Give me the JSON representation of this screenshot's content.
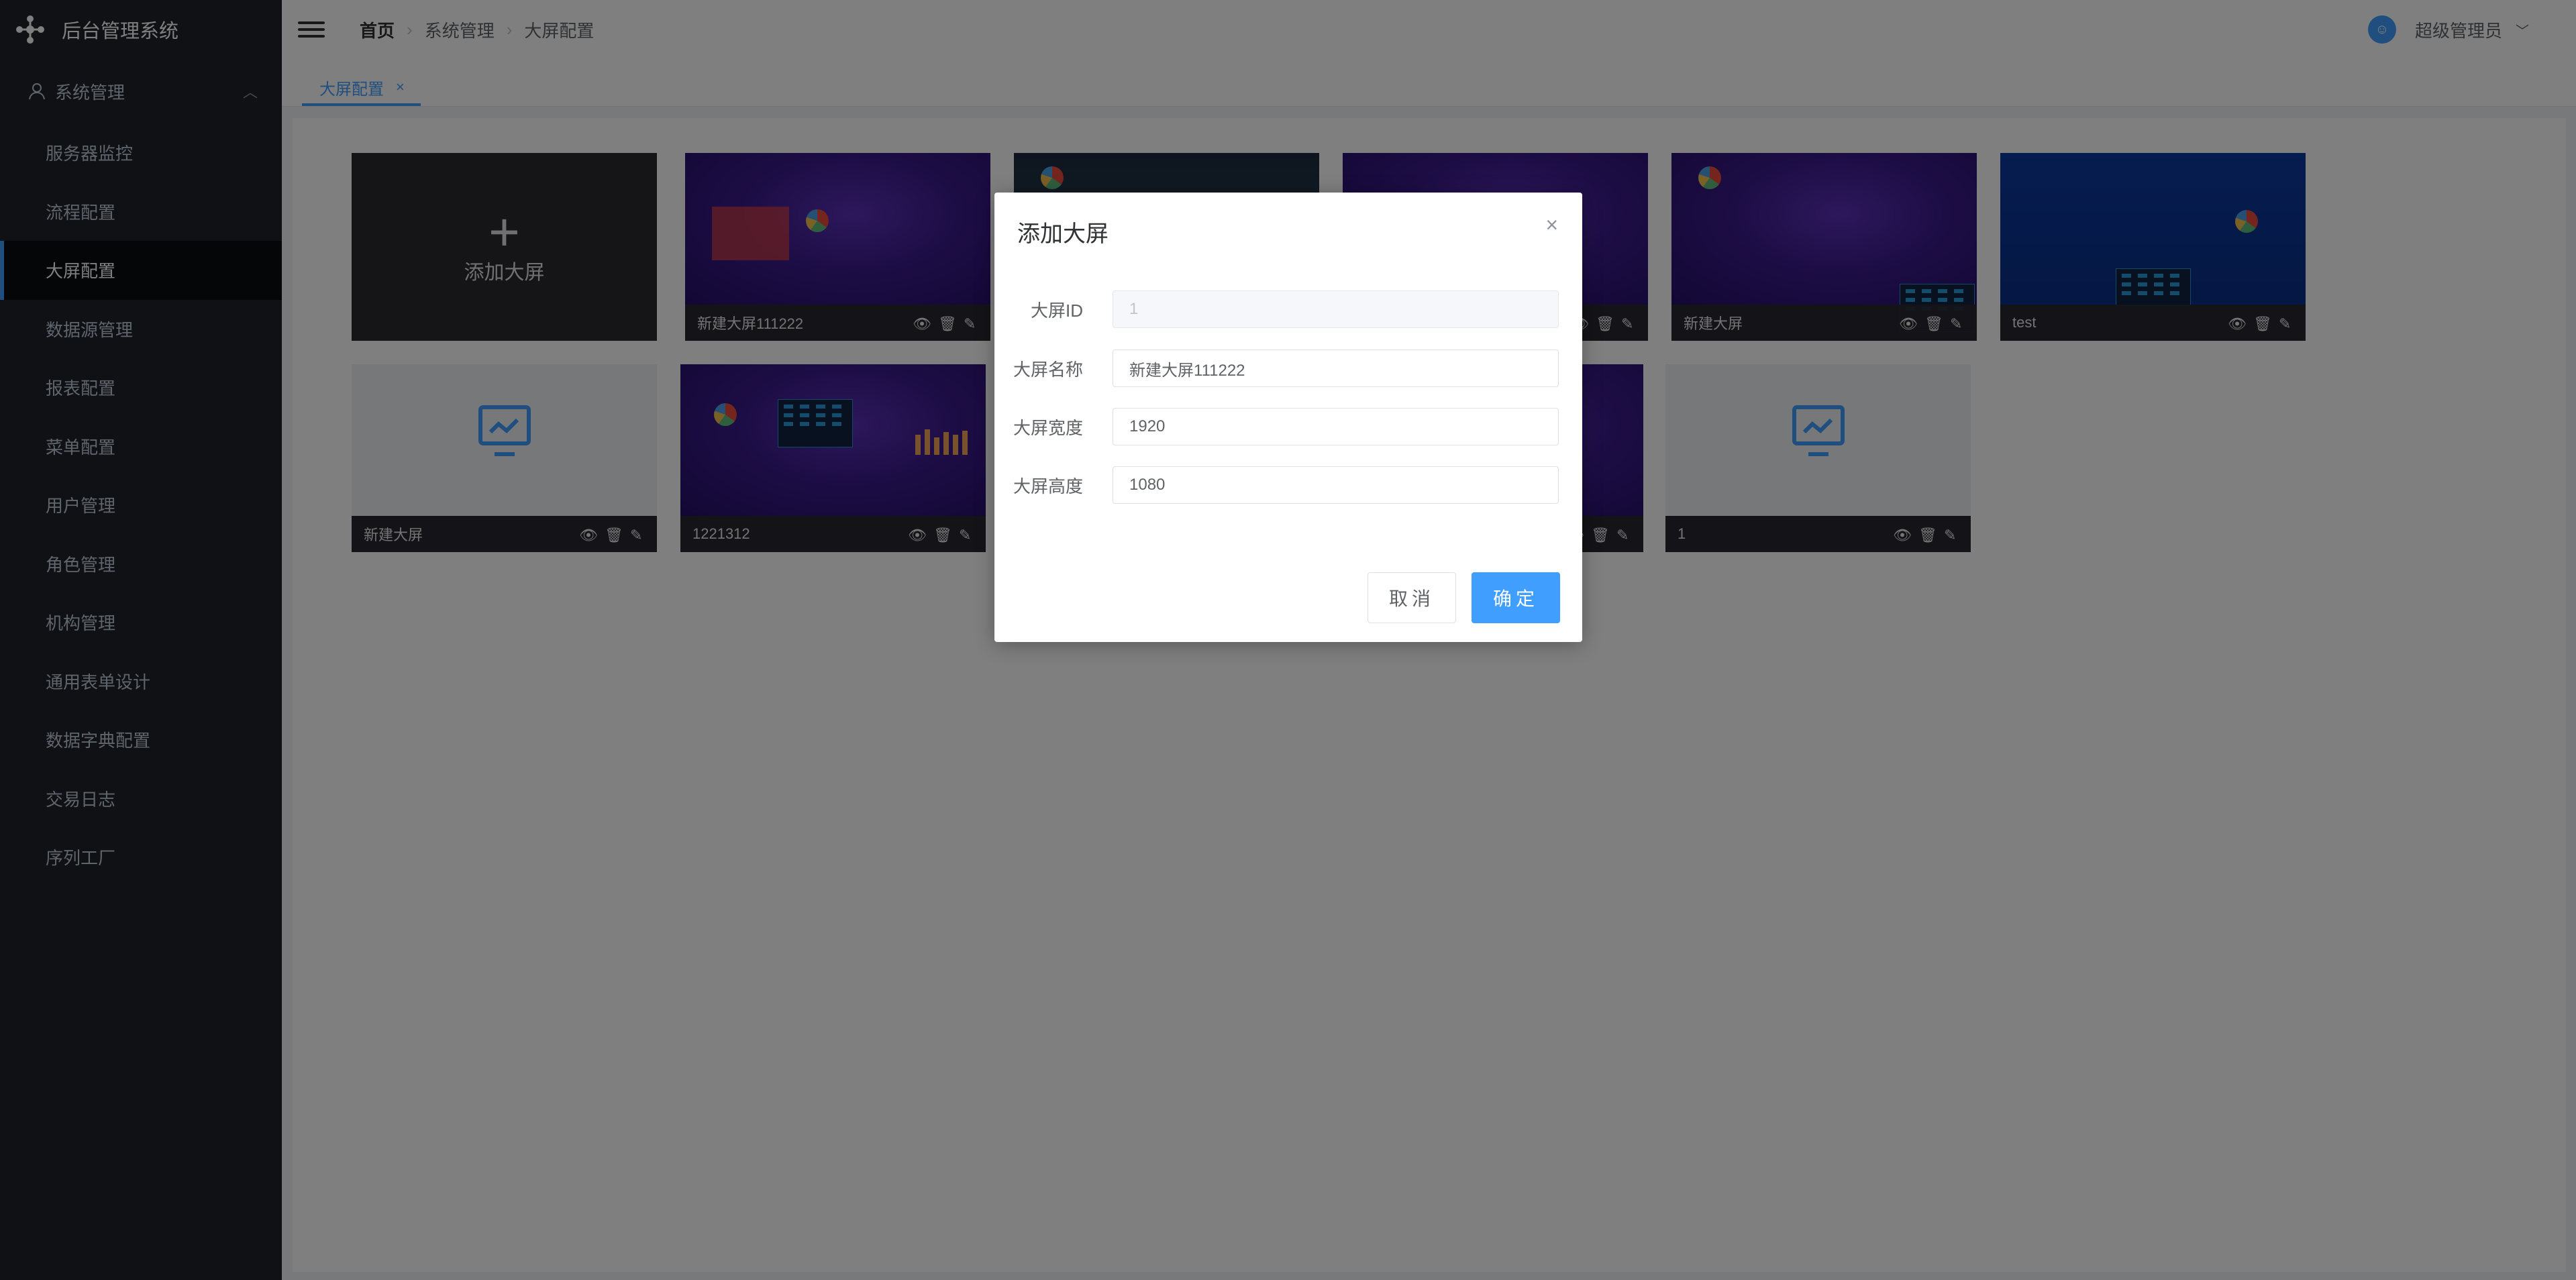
{
  "app": {
    "title": "后台管理系统"
  },
  "sidebar": {
    "group_label": "系统管理",
    "items": [
      {
        "label": "服务器监控"
      },
      {
        "label": "流程配置"
      },
      {
        "label": "大屏配置"
      },
      {
        "label": "数据源管理"
      },
      {
        "label": "报表配置"
      },
      {
        "label": "菜单配置"
      },
      {
        "label": "用户管理"
      },
      {
        "label": "角色管理"
      },
      {
        "label": "机构管理"
      },
      {
        "label": "通用表单设计"
      },
      {
        "label": "数据字典配置"
      },
      {
        "label": "交易日志"
      },
      {
        "label": "序列工厂"
      }
    ],
    "active_index": 2
  },
  "header": {
    "breadcrumb": [
      "首页",
      "系统管理",
      "大屏配置"
    ],
    "user_name": "超级管理员"
  },
  "tabs": [
    {
      "label": "大屏配置",
      "close": "×"
    }
  ],
  "cards": {
    "add_label": "添加大屏",
    "plus": "+",
    "row1": [
      {
        "name": "新建大屏111222"
      },
      {
        "name": ""
      },
      {
        "name": ""
      },
      {
        "name": "新建大屏"
      },
      {
        "name": "test"
      }
    ],
    "row2": [
      {
        "name": "新建大屏"
      },
      {
        "name": "1221312"
      },
      {
        "name": ""
      },
      {
        "name": "1"
      }
    ]
  },
  "dialog": {
    "title": "添加大屏",
    "close": "×",
    "fields": {
      "id": {
        "label": "大屏ID",
        "value": "1"
      },
      "name": {
        "label": "大屏名称",
        "value": "新建大屏111222"
      },
      "width": {
        "label": "大屏宽度",
        "value": "1920"
      },
      "height": {
        "label": "大屏高度",
        "value": "1080"
      }
    },
    "cancel_label": "取消",
    "ok_label": "确定"
  },
  "colors": {
    "primary": "#409eff",
    "sidebar_bg": "#1f2229",
    "active_item_bg": "#0a0c10"
  }
}
